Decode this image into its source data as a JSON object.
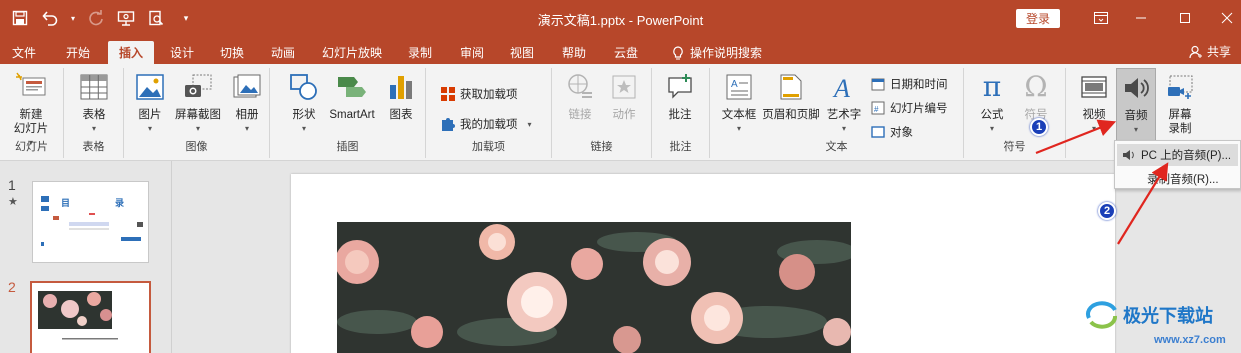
{
  "titlebar": {
    "doc_title": "演示文稿1.pptx  -  PowerPoint",
    "login_label": "登录",
    "qat_icons": [
      "save-icon",
      "undo-icon",
      "redo-icon",
      "present-icon",
      "preview-icon",
      "customize-icon"
    ]
  },
  "tabs": [
    {
      "label": "文件"
    },
    {
      "label": "开始"
    },
    {
      "label": "插入",
      "active": true
    },
    {
      "label": "设计"
    },
    {
      "label": "切换"
    },
    {
      "label": "动画"
    },
    {
      "label": "幻灯片放映"
    },
    {
      "label": "录制"
    },
    {
      "label": "审阅"
    },
    {
      "label": "视图"
    },
    {
      "label": "帮助"
    },
    {
      "label": "云盘"
    }
  ],
  "tell_me": "操作说明搜索",
  "share_label": "共享",
  "ribbon": {
    "groups": {
      "slides": "幻灯片",
      "tables": "表格",
      "images": "图像",
      "illustrations": "插图",
      "addins": "加载项",
      "links": "链接",
      "comments": "批注",
      "text": "文本",
      "symbols": "符号"
    },
    "buttons": {
      "new_slide_1": "新建",
      "new_slide_2": "幻灯片",
      "table": "表格",
      "picture": "图片",
      "screenshot": "屏幕截图",
      "album": "相册",
      "shapes": "形状",
      "smartart": "SmartArt",
      "chart": "图表",
      "get_addins": "获取加载项",
      "my_addins": "我的加载项",
      "link": "链接",
      "action": "动作",
      "comment": "批注",
      "textbox": "文本框",
      "header_footer": "页眉和页脚",
      "wordart": "艺术字",
      "datetime": "日期和时间",
      "slide_number": "幻灯片编号",
      "object": "对象",
      "equation": "公式",
      "symbol": "符号",
      "video": "视频",
      "audio": "音频",
      "screen_rec_1": "屏幕",
      "screen_rec_2": "录制"
    }
  },
  "audio_menu": {
    "items": [
      {
        "label": "PC 上的音频(P)..."
      },
      {
        "label": "录制音频(R)..."
      }
    ]
  },
  "slides_panel": {
    "slides": [
      {
        "number": "1",
        "star": "★",
        "title_left": "目",
        "title_right": "录"
      },
      {
        "number": "2"
      }
    ]
  },
  "annotations": {
    "badge1": "1",
    "badge2": "2"
  },
  "watermark": {
    "text": "极光下载站",
    "url": "www.xz7.com"
  },
  "colors": {
    "accent": "#b7472a",
    "badge": "#1a3fb8",
    "arrow": "#e0261f"
  }
}
